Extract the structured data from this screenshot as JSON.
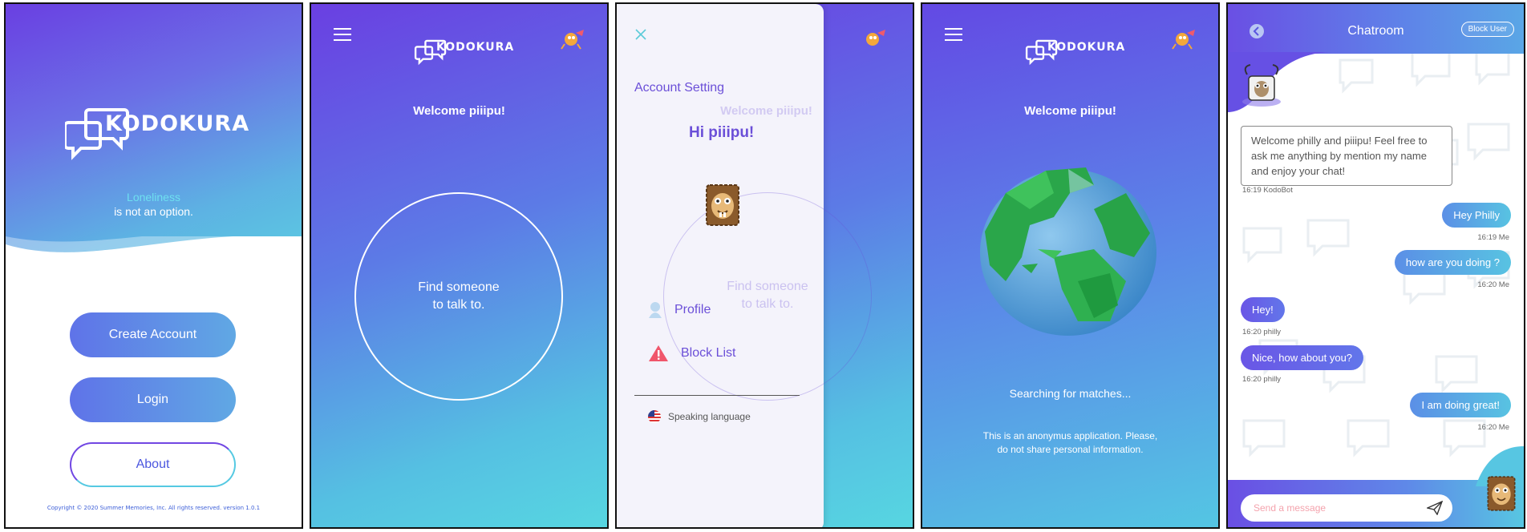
{
  "app": {
    "name": "KODOKURA"
  },
  "screen1": {
    "tagline_line1": "Loneliness",
    "tagline_line2": "is not an option.",
    "buttons": {
      "create": "Create Account",
      "login": "Login",
      "about": "About"
    },
    "copyright": "Copyright © 2020 Summer Memories, Inc. All rights reserved. version 1.0.1"
  },
  "screen2": {
    "welcome": "Welcome piiipu!",
    "find_line1": "Find someone",
    "find_line2": "to talk to."
  },
  "screen3": {
    "account_setting": "Account Setting",
    "greeting": "Hi piiipu!",
    "menu": {
      "profile": "Profile",
      "block_list": "Block List"
    },
    "language": "Speaking language",
    "bg_welcome": "Welcome piiipu!",
    "bg_find_line1": "Find someone",
    "bg_find_line2": "to talk to."
  },
  "screen4": {
    "welcome": "Welcome piiipu!",
    "searching": "Searching for matches...",
    "notice_line1": "This is an anonymus application. Please,",
    "notice_line2": "do not share personal information."
  },
  "screen5": {
    "title": "Chatroom",
    "block_user": "Block User",
    "bot_message": "Welcome philly and piiipu! Feel free to ask me anything by mention my name and enjoy your chat!",
    "bot_meta": "16:19 KodoBot",
    "messages": [
      {
        "side": "right",
        "text": "Hey Philly",
        "meta": "16:19 Me"
      },
      {
        "side": "right",
        "text": "how are you doing ?",
        "meta": "16:20 Me"
      },
      {
        "side": "left",
        "text": "Hey!",
        "meta": "16:20 philly"
      },
      {
        "side": "left",
        "text": "Nice, how about you?",
        "meta": "16:20 philly"
      },
      {
        "side": "right",
        "text": "I am doing great!",
        "meta": "16:20 Me"
      }
    ],
    "input_placeholder": "Send a message"
  },
  "colors": {
    "purple": "#6a3fe2",
    "blue": "#5b86e8",
    "cyan": "#57d6e1",
    "accent_text": "#6b4fd8",
    "warning": "#f0566b"
  },
  "icons": [
    "menu-icon",
    "close-icon",
    "back-icon",
    "send-icon",
    "profile-icon",
    "warning-icon",
    "us-flag-icon",
    "globe-icon",
    "avatar-icon",
    "chat-bubble-logo-icon"
  ]
}
